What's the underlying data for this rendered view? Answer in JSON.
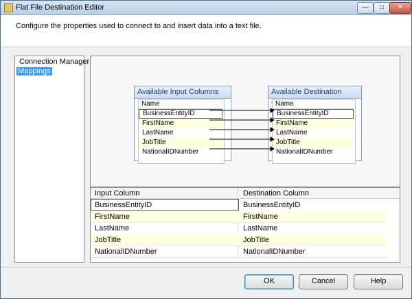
{
  "window": {
    "title": "Flat File Destination Editor",
    "buttons": {
      "minimize": "—",
      "maximize": "□",
      "close": "✕"
    }
  },
  "header": {
    "text": "Configure the properties used to connect to and insert data into a text file."
  },
  "nav": {
    "items": [
      {
        "label": "Connection Manager",
        "selected": false
      },
      {
        "label": "Mappings",
        "selected": true
      }
    ]
  },
  "input_box": {
    "title": "Available Input Columns",
    "column_header": "Name",
    "rows": [
      "BusinessEntityID",
      "FirstName",
      "LastName",
      "JobTitle",
      "NationalIDNumber"
    ]
  },
  "dest_box": {
    "title": "Available Destination Columns",
    "column_header": "Name",
    "rows": [
      "BusinessEntityID",
      "FirstName",
      "LastName",
      "JobTitle",
      "NationalIDNumber"
    ]
  },
  "grid": {
    "headers": {
      "input": "Input Column",
      "destination": "Destination Column"
    },
    "rows": [
      {
        "input": "BusinessEntityID",
        "destination": "BusinessEntityID"
      },
      {
        "input": "FirstName",
        "destination": "FirstName"
      },
      {
        "input": "LastName",
        "destination": "LastName"
      },
      {
        "input": "JobTitle",
        "destination": "JobTitle"
      },
      {
        "input": "NationalIDNumber",
        "destination": "NationalIDNumber"
      }
    ]
  },
  "footer": {
    "ok": "OK",
    "cancel": "Cancel",
    "help": "Help"
  }
}
